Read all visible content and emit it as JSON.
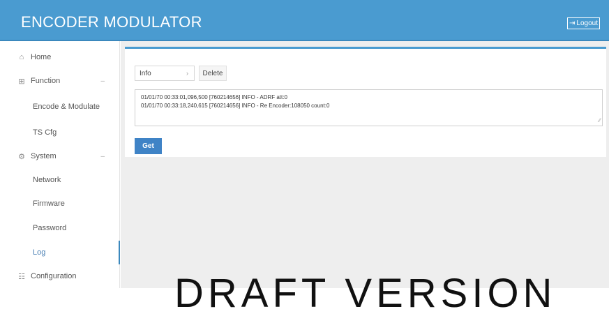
{
  "header": {
    "title": "ENCODER MODULATOR",
    "logout_label": "Logout",
    "logout_icon": "logout-icon"
  },
  "sidebar": {
    "items": [
      {
        "label": "Home",
        "icon": "home-icon"
      },
      {
        "label": "Function",
        "icon": "grid-icon"
      },
      {
        "label": "Encode & Modulate"
      },
      {
        "label": "TS Cfg"
      },
      {
        "label": "System",
        "icon": "gear-icon"
      },
      {
        "label": "Network"
      },
      {
        "label": "Firmware"
      },
      {
        "label": "Password"
      },
      {
        "label": "Log"
      },
      {
        "label": "Configuration",
        "icon": "document-icon"
      }
    ]
  },
  "log_panel": {
    "level_select_value": "Info",
    "delete_label": "Delete",
    "log_lines": [
      "01/01/70 00:33:01,096,500 [760214656] INFO  - ADRF att:0",
      "01/01/70 00:33:18,240,615 [760214656] INFO  - Re Encoder:108050 count:0"
    ],
    "get_label": "Get"
  },
  "watermark": "DRAFT VERSION",
  "colors": {
    "header_bg": "#4a9bd0",
    "accent": "#3f83c6",
    "main_bg": "#eeeeee"
  }
}
